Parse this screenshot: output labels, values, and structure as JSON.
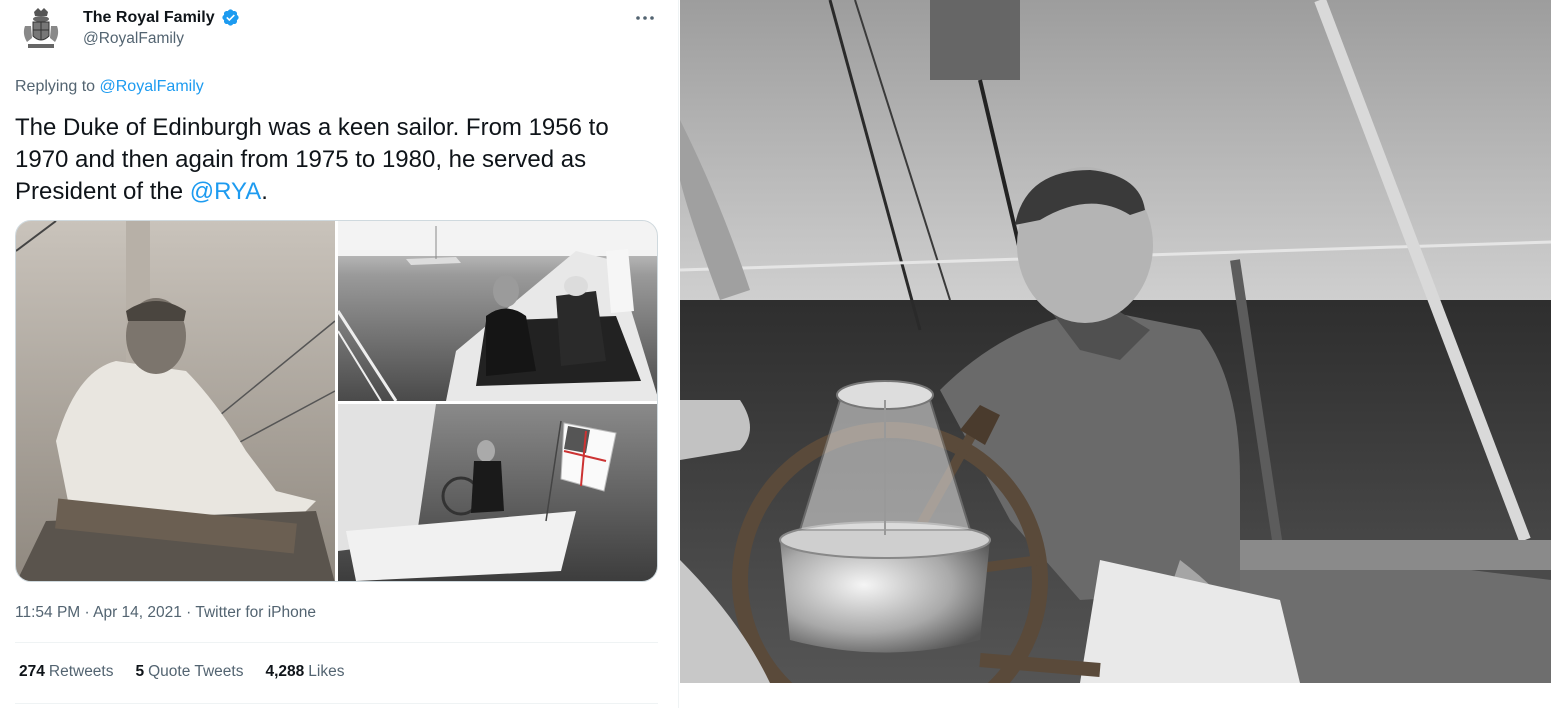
{
  "tweet": {
    "display_name": "The Royal Family",
    "handle": "@RoyalFamily",
    "replying_prefix": "Replying to ",
    "replying_to": "@RoyalFamily",
    "text_before": "The Duke of Edinburgh was a keen sailor. From 1956 to 1970 and then again from 1975 to 1980, he served as President of the ",
    "mention": "@RYA",
    "text_after": ".",
    "timestamp": "11:54 PM · Apr 14, 2021 · Twitter for iPhone",
    "stats": [
      {
        "count": "274",
        "label": "Retweets"
      },
      {
        "count": "5",
        "label": "Quote Tweets"
      },
      {
        "count": "4,288",
        "label": "Likes"
      }
    ]
  },
  "icons": {
    "avatar": "royal-coat-of-arms",
    "verified": "verified-badge-icon",
    "more": "more-options-icon"
  },
  "colors": {
    "accent": "#1d9bf0",
    "secondary_text": "#536471",
    "primary_text": "#0f1419"
  }
}
